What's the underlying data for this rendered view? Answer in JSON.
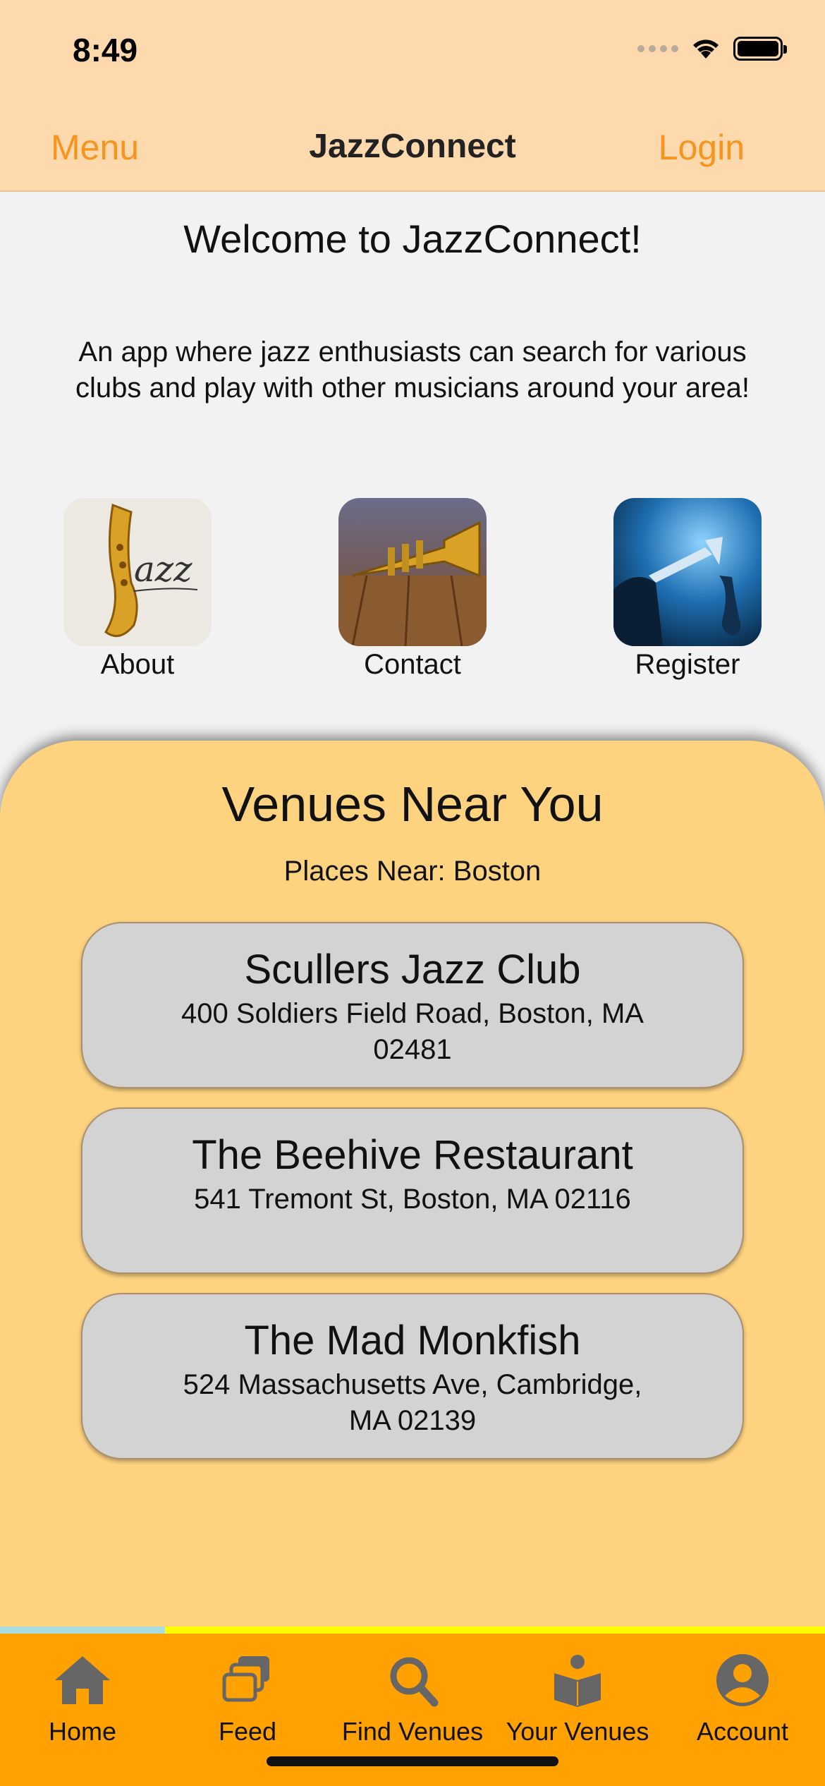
{
  "status_bar": {
    "time": "8:49"
  },
  "nav": {
    "left": "Menu",
    "title": "JazzConnect",
    "right": "Login"
  },
  "welcome": "Welcome to JazzConnect!",
  "intro_line1": "An app where jazz enthusiasts can search for various",
  "intro_line2": "clubs and play with other musicians around your area!",
  "tiles": [
    {
      "label": "About",
      "image": "saxophone-jazz-image"
    },
    {
      "label": "Contact",
      "image": "trumpet-image"
    },
    {
      "label": "Register",
      "image": "jazz-band-image"
    }
  ],
  "venues_panel": {
    "title": "Venues Near You",
    "subtitle": "Places Near: Boston",
    "venues": [
      {
        "name": "Scullers Jazz Club",
        "address": "400 Soldiers Field Road, Boston, MA 02481"
      },
      {
        "name": "The Beehive Restaurant",
        "address": "541 Tremont St, Boston, MA 02116"
      },
      {
        "name": "The Mad Monkfish",
        "address": "524 Massachusetts Ave, Cambridge, MA 02139"
      }
    ]
  },
  "tabs": [
    {
      "label": "Home",
      "icon": "home-icon"
    },
    {
      "label": "Feed",
      "icon": "feed-icon"
    },
    {
      "label": "Find Venues",
      "icon": "search-icon"
    },
    {
      "label": "Your Venues",
      "icon": "reading-person-icon"
    },
    {
      "label": "Account",
      "icon": "account-icon"
    }
  ],
  "colors": {
    "nav_bg": "#fed9ae",
    "nav_accent": "#f7941d",
    "panel_bg": "#fed380",
    "card_bg": "#d3d3d3",
    "tabbar_bg": "#ffa100",
    "tab_icon": "#666666"
  }
}
